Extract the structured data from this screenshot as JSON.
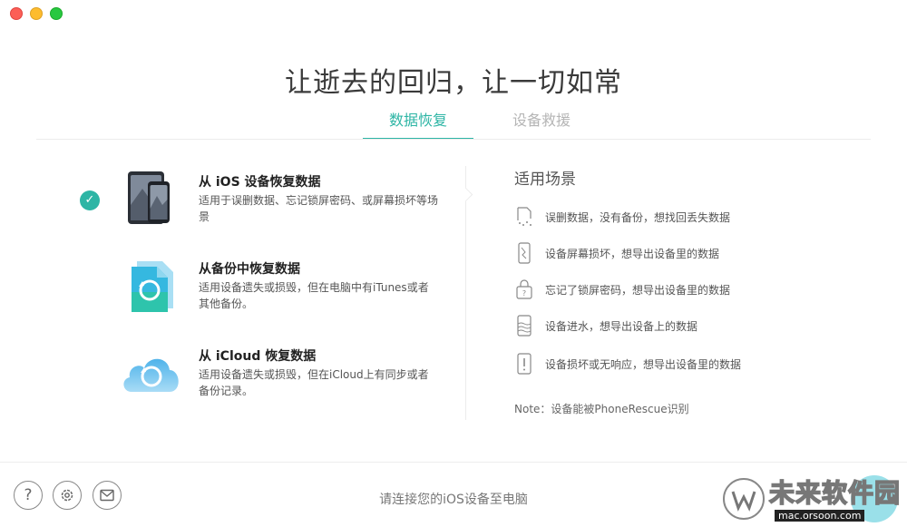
{
  "window": {
    "traffic_lights": [
      "close",
      "minimize",
      "zoom"
    ]
  },
  "headline": "让逝去的回归，让一切如常",
  "tabs": [
    {
      "label": "数据恢复",
      "active": true
    },
    {
      "label": "设备救援",
      "active": false
    }
  ],
  "options": [
    {
      "title": "从 iOS 设备恢复数据",
      "desc": "适用于误删数据、忘记锁屏密码、或屏幕损坏等场景",
      "selected": true,
      "icon": "ios-devices-icon"
    },
    {
      "title": "从备份中恢复数据",
      "desc": "适用设备遗失或损毁，但在电脑中有iTunes或者其他备份。",
      "selected": false,
      "icon": "backup-file-icon"
    },
    {
      "title": "从 iCloud 恢复数据",
      "desc": "适用设备遗失或损毁，但在iCloud上有同步或者备份记录。",
      "selected": false,
      "icon": "icloud-restore-icon"
    }
  ],
  "scenarios": {
    "title": "适用场景",
    "items": [
      {
        "text": "误删数据，没有备份，想找回丢失数据",
        "icon": "deleted-file-icon"
      },
      {
        "text": "设备屏幕损坏，想导出设备里的数据",
        "icon": "broken-phone-icon"
      },
      {
        "text": "忘记了锁屏密码，想导出设备里的数据",
        "icon": "locked-phone-icon"
      },
      {
        "text": "设备进水，想导出设备上的数据",
        "icon": "water-phone-icon"
      },
      {
        "text": "设备损坏或无响应，想导出设备里的数据",
        "icon": "warning-phone-icon"
      }
    ],
    "note": "Note：设备能被PhoneRescue识别"
  },
  "footer": {
    "status": "请连接您的iOS设备至电脑",
    "buttons": [
      "help-icon",
      "settings-icon",
      "mail-icon"
    ]
  },
  "watermark": {
    "text": "未来软件园",
    "url": "mac.orsoon.com"
  },
  "colors": {
    "accent": "#2db5a5",
    "inactive_tab": "#b5b5b5"
  }
}
